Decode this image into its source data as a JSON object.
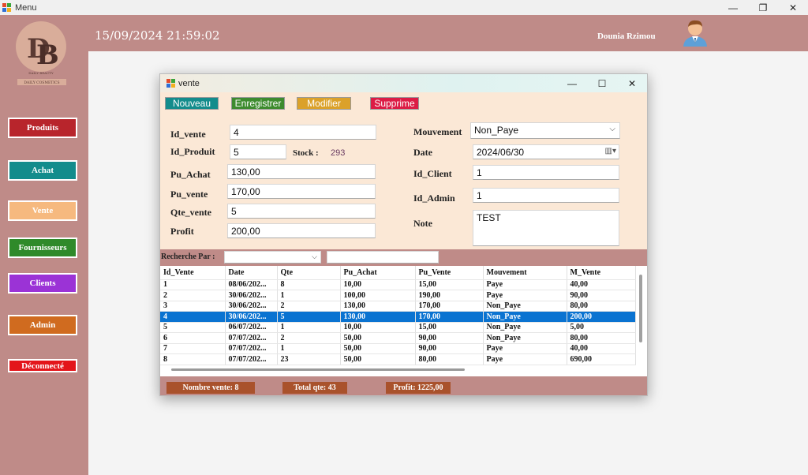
{
  "window": {
    "title": "Menu",
    "minimize": "—",
    "maximize": "❐",
    "close": "✕"
  },
  "header": {
    "datetime": "15/09/2024 21:59:02",
    "username": "Dounia Rzimou"
  },
  "logo": {
    "text_top": "DAILY BEAUTY",
    "text_bottom": "DAILY COSMETICS"
  },
  "sidebar": {
    "items": [
      {
        "label": "Produits",
        "color": "#b8252c"
      },
      {
        "label": "Achat",
        "color": "#138c8c"
      },
      {
        "label": "Vente",
        "color": "#f6b97f"
      },
      {
        "label": "Fournisseurs",
        "color": "#2f8a2a"
      },
      {
        "label": "Clients",
        "color": "#9b33d6"
      },
      {
        "label": "Admin",
        "color": "#d06b1f"
      },
      {
        "label": "Déconnecté",
        "color": "#e3151a"
      }
    ]
  },
  "dialog": {
    "title": "vente",
    "minimize": "—",
    "maximize": "☐",
    "close": "✕",
    "toolbar": {
      "nouveau": "Nouveau",
      "enregistrer": "Enregistrer",
      "modifier": "Modifier",
      "supprime": "Supprime"
    },
    "form": {
      "id_vente_label": "Id_vente",
      "id_vente": "4",
      "id_produit_label": "Id_Produit",
      "id_produit": "5",
      "stock_label": "Stock :",
      "stock": "293",
      "pu_achat_label": "Pu_Achat",
      "pu_achat": "130,00",
      "pu_vente_label": "Pu_vente",
      "pu_vente": "170,00",
      "qte_vente_label": "Qte_vente",
      "qte_vente": "5",
      "profit_label": "Profit",
      "profit": "200,00",
      "mouvement_label": "Mouvement",
      "mouvement": "Non_Paye",
      "date_label": "Date",
      "date": "2024/06/30",
      "id_client_label": "Id_Client",
      "id_client": "1",
      "id_admin_label": "Id_Admin",
      "id_admin": "1",
      "note_label": "Note",
      "note": "TEST"
    },
    "search": {
      "label": "Recherche Par :",
      "select": "",
      "text": ""
    },
    "table": {
      "columns": [
        "Id_Vente",
        "Date",
        "Qte",
        "Pu_Achat",
        "Pu_Vente",
        "Mouvement",
        "M_Vente"
      ],
      "rows": [
        [
          "1",
          "08/06/202...",
          "8",
          "10,00",
          "15,00",
          "Paye",
          "40,00"
        ],
        [
          "2",
          "30/06/202...",
          "1",
          "100,00",
          "190,00",
          "Paye",
          "90,00"
        ],
        [
          "3",
          "30/06/202...",
          "2",
          "130,00",
          "170,00",
          "Non_Paye",
          "80,00"
        ],
        [
          "4",
          "30/06/202...",
          "5",
          "130,00",
          "170,00",
          "Non_Paye",
          "200,00"
        ],
        [
          "5",
          "06/07/202...",
          "1",
          "10,00",
          "15,00",
          "Non_Paye",
          "5,00"
        ],
        [
          "6",
          "07/07/202...",
          "2",
          "50,00",
          "90,00",
          "Non_Paye",
          "80,00"
        ],
        [
          "7",
          "07/07/202...",
          "1",
          "50,00",
          "90,00",
          "Paye",
          "40,00"
        ],
        [
          "8",
          "07/07/202...",
          "23",
          "50,00",
          "80,00",
          "Paye",
          "690,00"
        ]
      ],
      "selected_row": 3
    },
    "footer": {
      "nombre_vente": "Nombre vente: 8",
      "total_qte": "Total qte: 43",
      "profit": "Profit: 1225,00"
    }
  }
}
